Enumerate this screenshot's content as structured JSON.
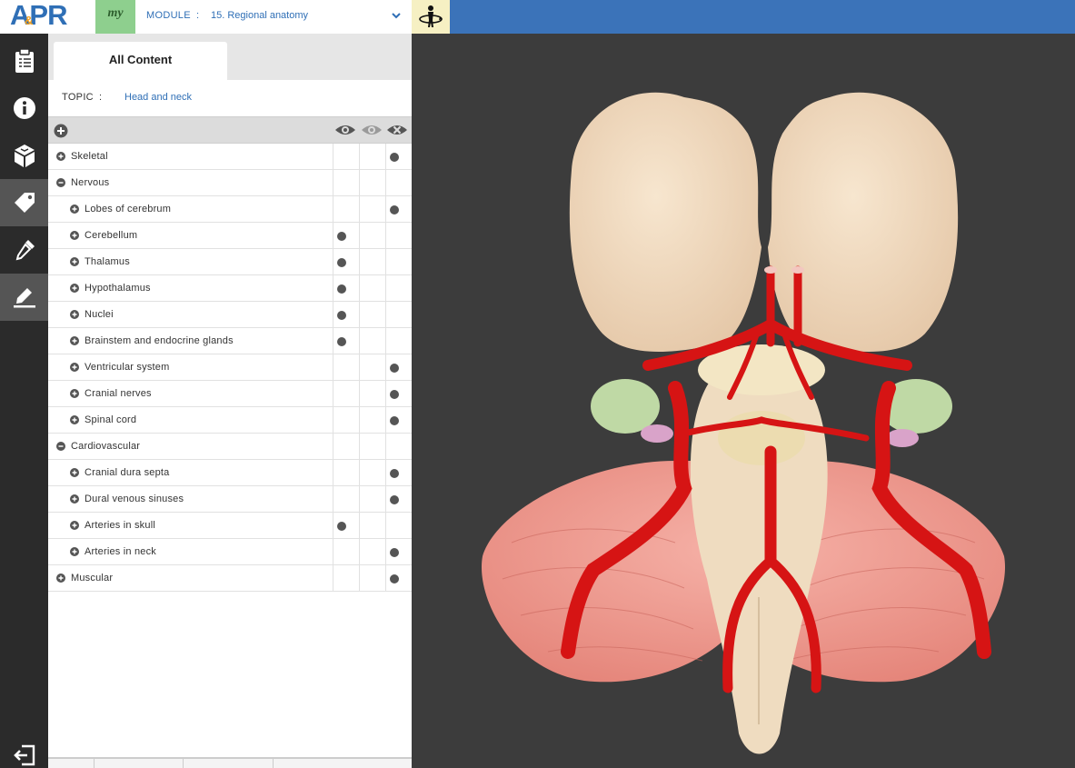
{
  "app": {
    "logo_text": "APR",
    "logo_amp": "&",
    "badge": "my"
  },
  "module": {
    "label": "MODULE",
    "separator": ":",
    "value": "15. Regional anatomy"
  },
  "tabs": [
    {
      "label": "All Content",
      "active": true
    }
  ],
  "topic": {
    "label": "TOPIC",
    "separator": ":",
    "value": "Head and neck"
  },
  "sidebar": {
    "items": [
      {
        "icon": "clipboard-icon"
      },
      {
        "icon": "info-icon"
      },
      {
        "icon": "cube-icon"
      },
      {
        "icon": "tag-icon",
        "active": true
      },
      {
        "icon": "dropper-icon"
      },
      {
        "icon": "highlighter-icon",
        "active": true
      }
    ],
    "exit_icon": "exit-icon"
  },
  "tree_header": {
    "columns": [
      "show-icon",
      "transparent-icon",
      "hide-icon"
    ]
  },
  "tree": [
    {
      "label": "Skeletal",
      "level": 0,
      "state": "collapsed",
      "mark": "hide"
    },
    {
      "label": "Nervous",
      "level": 0,
      "state": "expanded",
      "mark": "none"
    },
    {
      "label": "Lobes of cerebrum",
      "level": 1,
      "state": "collapsed",
      "mark": "hide"
    },
    {
      "label": "Cerebellum",
      "level": 1,
      "state": "collapsed",
      "mark": "show"
    },
    {
      "label": "Thalamus",
      "level": 1,
      "state": "collapsed",
      "mark": "show"
    },
    {
      "label": "Hypothalamus",
      "level": 1,
      "state": "collapsed",
      "mark": "show"
    },
    {
      "label": "Nuclei",
      "level": 1,
      "state": "collapsed",
      "mark": "show"
    },
    {
      "label": "Brainstem and endocrine glands",
      "level": 1,
      "state": "collapsed",
      "mark": "show"
    },
    {
      "label": "Ventricular system",
      "level": 1,
      "state": "collapsed",
      "mark": "hide"
    },
    {
      "label": "Cranial nerves",
      "level": 1,
      "state": "collapsed",
      "mark": "hide"
    },
    {
      "label": "Spinal cord",
      "level": 1,
      "state": "collapsed",
      "mark": "hide"
    },
    {
      "label": "Cardiovascular",
      "level": 0,
      "state": "expanded",
      "mark": "none"
    },
    {
      "label": "Cranial dura septa",
      "level": 1,
      "state": "collapsed",
      "mark": "hide"
    },
    {
      "label": "Dural venous sinuses",
      "level": 1,
      "state": "collapsed",
      "mark": "hide"
    },
    {
      "label": "Arteries in skull",
      "level": 1,
      "state": "collapsed",
      "mark": "show"
    },
    {
      "label": "Arteries in neck",
      "level": 1,
      "state": "collapsed",
      "mark": "hide"
    },
    {
      "label": "Muscular",
      "level": 0,
      "state": "collapsed",
      "mark": "hide"
    }
  ],
  "colors": {
    "topbar": "#3b73b9",
    "brand_blue": "#2f6fb6",
    "brand_orange": "#f7a11a",
    "badge_green": "#8ecf8e",
    "artery_red": "#d61414",
    "cerebrum": "#f2dcc0",
    "cerebellum": "#ee9a92",
    "viewport_bg": "#3c3c3c"
  }
}
